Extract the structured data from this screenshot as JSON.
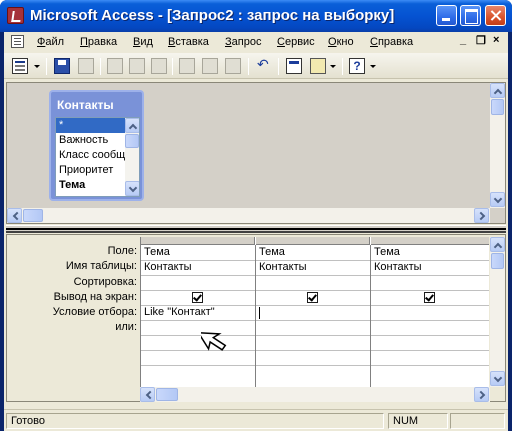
{
  "window": {
    "title": "Microsoft Access - [Запрос2 : запрос на выборку]",
    "icon": "access-icon"
  },
  "menu": {
    "items": [
      "Файл",
      "Правка",
      "Вид",
      "Вставка",
      "Запрос",
      "Сервис",
      "Окно",
      "Справка"
    ],
    "mdi_controls": [
      "_",
      "❐",
      "×"
    ]
  },
  "toolbar": {
    "icons": [
      "view-icon",
      "save-icon",
      "search-icon",
      "print-icon",
      "print-preview-icon",
      "spelling-icon",
      "cut-icon",
      "copy-icon",
      "paste-icon",
      "undo-icon",
      "query-type-icon",
      "build-icon",
      "help-icon"
    ]
  },
  "table_box": {
    "title": "Контакты",
    "fields": [
      "*",
      "Важность",
      "Класс сообщения",
      "Приоритет",
      "Тема"
    ],
    "selected_index": 0,
    "bold_index": 4
  },
  "query_grid": {
    "row_labels": [
      "Поле:",
      "Имя таблицы:",
      "Сортировка:",
      "Вывод на экран:",
      "Условие отбора:",
      "или:"
    ],
    "columns": [
      {
        "field": "Тема",
        "table": "Контакты",
        "sort": "",
        "show": true,
        "criteria": "Like \"Контакт\"",
        "or": ""
      },
      {
        "field": "Тема",
        "table": "Контакты",
        "sort": "",
        "show": true,
        "criteria": "",
        "or": ""
      },
      {
        "field": "Тема",
        "table": "Контакты",
        "sort": "",
        "show": true,
        "criteria": "",
        "or": ""
      }
    ]
  },
  "status": {
    "text": "Готово",
    "num": "NUM"
  },
  "colors": {
    "title_bar": "#0553d2",
    "table_box": "#7a92d8",
    "selection": "#316ac5"
  }
}
